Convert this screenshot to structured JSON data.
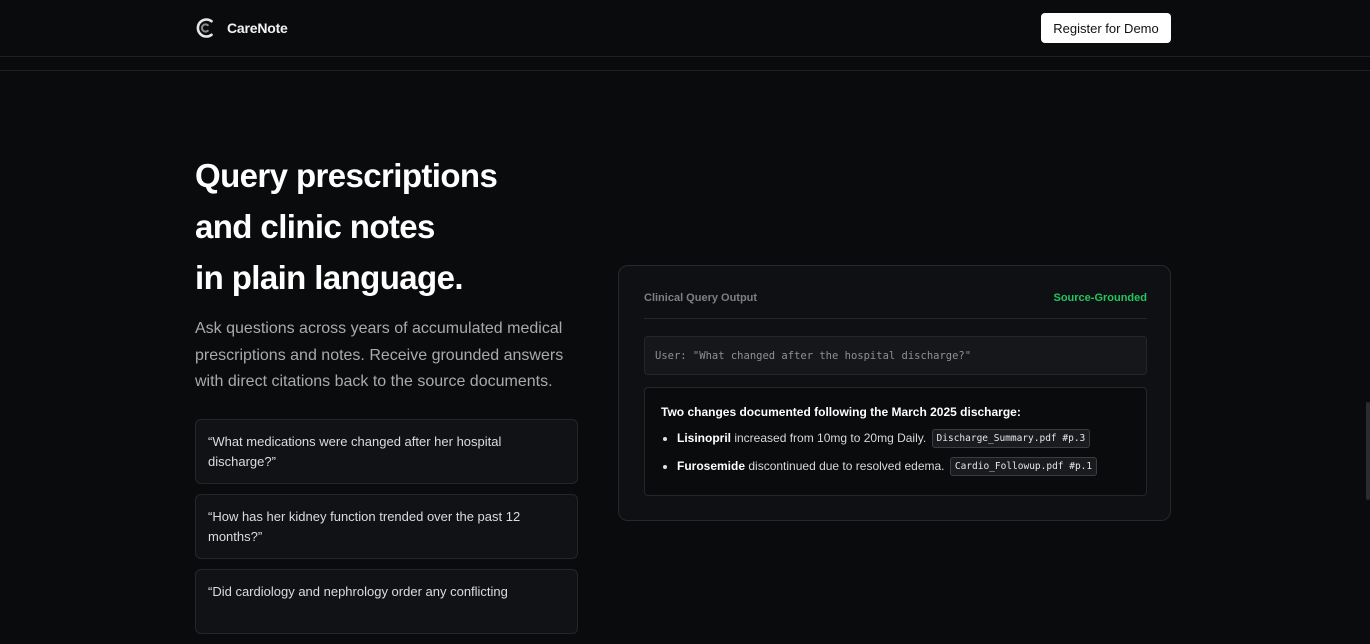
{
  "nav": {
    "brand": "CareNote",
    "cta_label": "Register for Demo"
  },
  "hero": {
    "title_lines": [
      "Query prescriptions",
      "and clinic notes",
      "in plain language."
    ],
    "subtitle": "Ask questions across years of accumulated medical prescriptions and notes. Receive grounded answers with direct citations back to the source documents."
  },
  "examples": [
    "“What medications were changed after her hospital discharge?”",
    "“How has her kidney function trended over the past 12 months?”",
    "“Did cardiology and nephrology order any conflicting"
  ],
  "panel": {
    "title": "Clinical Query Output",
    "status": "Source-Grounded",
    "status_color": "#22c55e",
    "query": "User: \"What changed after the hospital discharge?\"",
    "answer_heading": "Two changes documented following the March 2025 discharge:",
    "items": [
      {
        "drug": "Lisinopril",
        "text": "increased from 10mg to 20mg Daily.",
        "citation": "Discharge_Summary.pdf #p.3"
      },
      {
        "drug": "Furosemide",
        "text": "discontinued due to resolved edema.",
        "citation": "Cardio_Followup.pdf #p.1"
      }
    ]
  },
  "icons": {
    "brand_logo": "carenote-logo-icon"
  }
}
